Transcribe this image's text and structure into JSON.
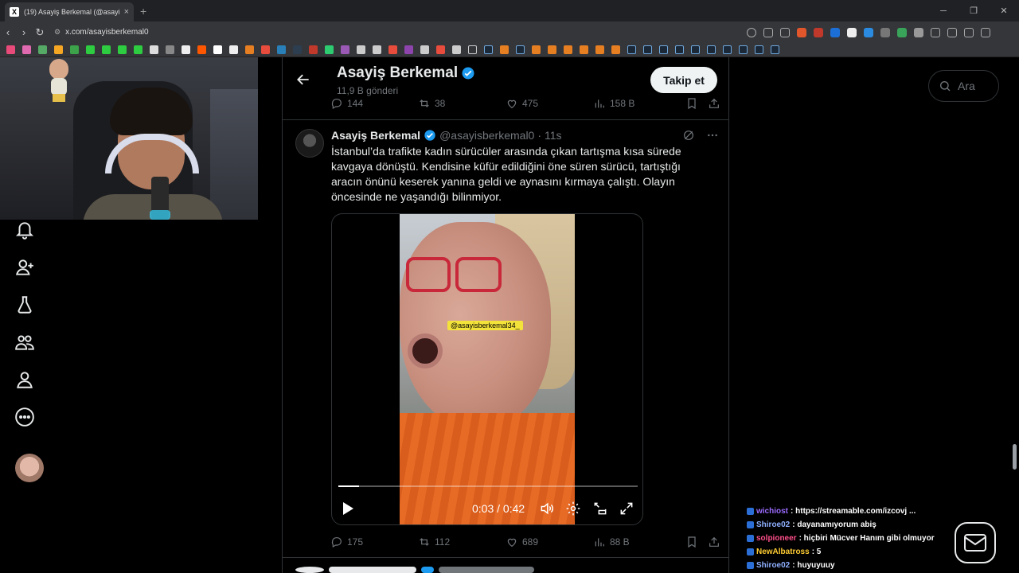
{
  "browser": {
    "tab_title": "(19) Asayiş Berkemal (@asayisbe",
    "tab_close": "×",
    "new_tab": "+",
    "url": "x.com/asayisberkemal0"
  },
  "profile": {
    "name": "Asayiş Berkemal",
    "post_count": "11,9 B gönderi",
    "follow_label": "Takip et"
  },
  "prev_tweet_stats": {
    "replies": "144",
    "reposts": "38",
    "likes": "475",
    "views": "158 B"
  },
  "tweet": {
    "author": "Asayiş Berkemal",
    "handle": "@asayisberkemal0",
    "separator": "·",
    "time": "11s",
    "text": "İstanbul’da trafikte kadın sürücüler arasında çıkan tartışma kısa sürede kavgaya dönüştü. Kendisine küfür edildiğini öne süren sürücü, tartıştığı aracın önünü keserek yanına geldi ve aynasını kırmaya çalıştı. Olayın öncesinde ne yaşandığı bilinmiyor.",
    "video": {
      "watermark": "@asayisberkemal34_",
      "time": "0:03 / 0:42",
      "progress": 0.07
    },
    "stats": {
      "replies": "175",
      "reposts": "112",
      "likes": "689",
      "views": "88 B"
    }
  },
  "search": {
    "placeholder": "Ara"
  },
  "chat": [
    {
      "user": "wichiost",
      "color": "#9b6bff",
      "msg": ": https://streamable.com/izcovj ..."
    },
    {
      "user": "Shiroe02",
      "color": "#8fb0ff",
      "msg": ": dayanamıyorum abiş"
    },
    {
      "user": "solpioneer",
      "color": "#ff4f8b",
      "msg": ": hiçbiri Mücver Hanım gibi olmuyor"
    },
    {
      "user": "NewAlbatross",
      "color": "#ffcc33",
      "msg": ": 5"
    },
    {
      "user": "Shiroe02",
      "color": "#8fb0ff",
      "msg": ": huyuyuuy"
    }
  ],
  "colors": {
    "accent": "#1d9bf0",
    "background": "#000000",
    "muted_text": "#71767b"
  }
}
